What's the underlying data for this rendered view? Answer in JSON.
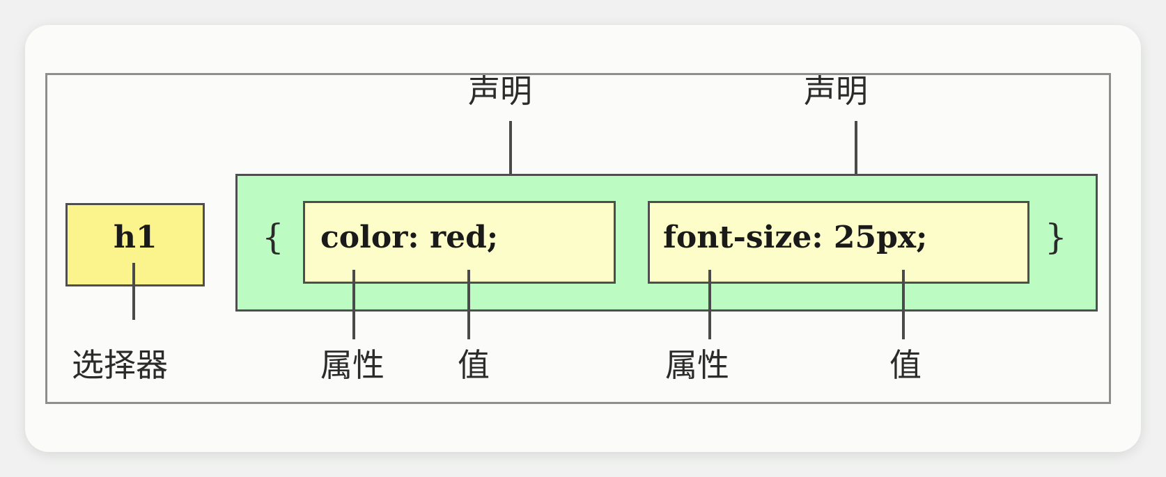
{
  "diagram": {
    "selector": {
      "code": "h1",
      "label": "选择器"
    },
    "braces": {
      "open": "{",
      "close": "}"
    },
    "declarations": [
      {
        "code": "color: red;",
        "declaration_label": "声明",
        "property_label": "属性",
        "value_label": "值"
      },
      {
        "code": "font-size: 25px;",
        "declaration_label": "声明",
        "property_label": "属性",
        "value_label": "值"
      }
    ],
    "colors": {
      "selector_fill": "#fbf38b",
      "block_fill": "#bcfbc1",
      "declaration_fill": "#fdfdc9",
      "frame_border": "#8e8e8e",
      "line_color": "#4a4a4a"
    }
  }
}
